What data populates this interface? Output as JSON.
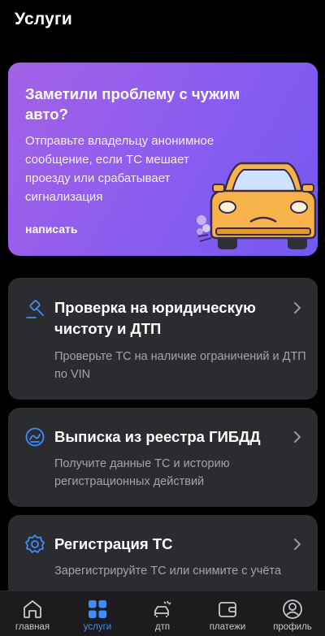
{
  "header": {
    "title": "Услуги"
  },
  "promo": {
    "title": "Заметили проблему с чужим авто?",
    "text": "Отправьте владельцу анонимное сообщение, если ТС мешает проезду или срабатывает сигнализация",
    "action": "написать",
    "car_icon": "yellow-car-illustration"
  },
  "services": [
    {
      "icon": "gavel-icon",
      "title": "Проверка на юридическую чистоту и ДТП",
      "desc": "Проверьте ТС на наличие ограничений и ДТП по VIN"
    },
    {
      "icon": "document-icon",
      "title": "Выписка из реестра ГИБДД",
      "desc": "Получите данные ТС и историю регистрационных действий"
    },
    {
      "icon": "badge-icon",
      "title": "Регистрация ТС",
      "desc": "Зарегистрируйте ТС или снимите с учёта"
    }
  ],
  "tabs": [
    {
      "label": "главная",
      "icon": "home-icon",
      "active": false
    },
    {
      "label": "услуги",
      "icon": "grid-icon",
      "active": true
    },
    {
      "label": "дтп",
      "icon": "crash-car-icon",
      "active": false
    },
    {
      "label": "платежи",
      "icon": "wallet-icon",
      "active": false
    },
    {
      "label": "профиль",
      "icon": "user-icon",
      "active": false
    }
  ],
  "colors": {
    "accent": "#3f8cff",
    "card": "#2b2c30",
    "promo_start": "#a461e6",
    "promo_end": "#7358f2",
    "car": "#f7b34a"
  }
}
